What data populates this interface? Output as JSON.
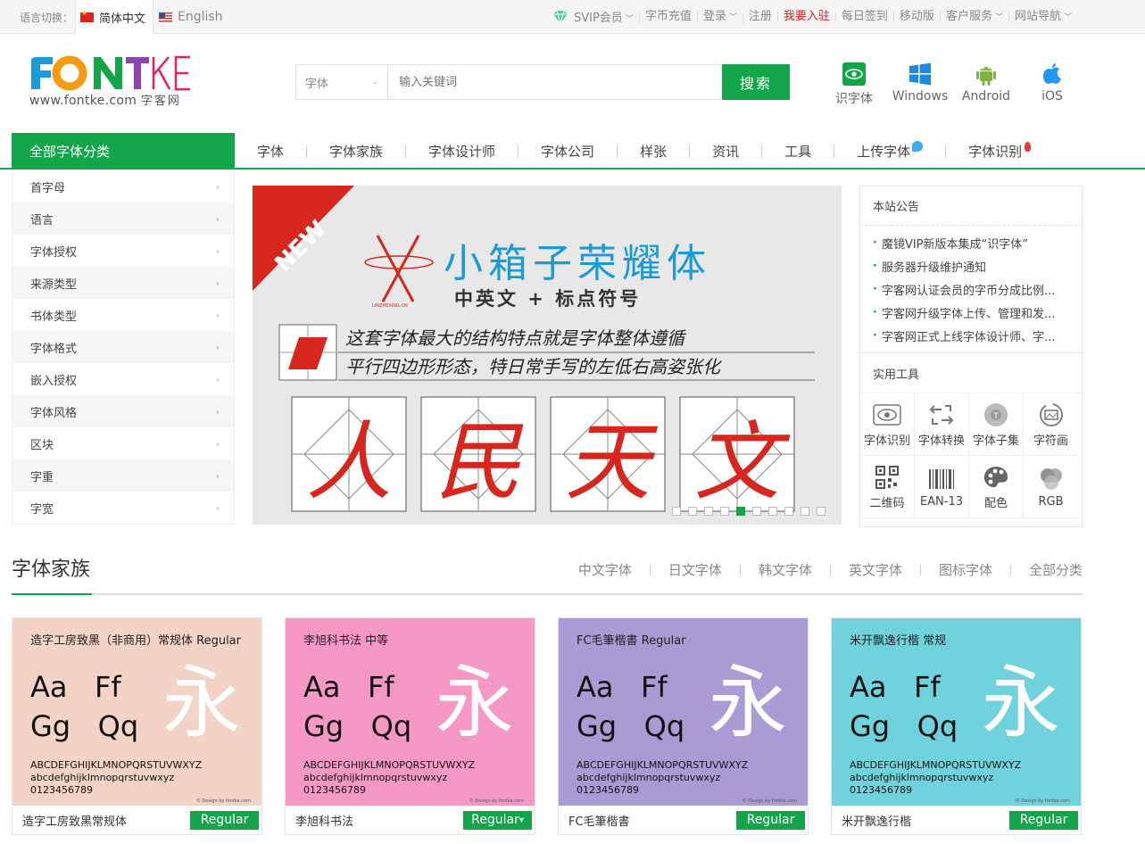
{
  "topbar": {
    "lang_label": "语言切换：",
    "lang_cn": "简体中文",
    "lang_en": "English",
    "links": [
      {
        "label": "SVIP会员",
        "arrow": true,
        "highlight": false
      },
      {
        "label": "字币充值",
        "arrow": false,
        "highlight": false
      },
      {
        "label": "登录",
        "arrow": true,
        "highlight": false
      },
      {
        "label": "注册",
        "arrow": false,
        "highlight": false
      },
      {
        "label": "我要入驻",
        "arrow": false,
        "highlight": true
      },
      {
        "label": "每日签到",
        "arrow": false,
        "highlight": false
      },
      {
        "label": "移动版",
        "arrow": false,
        "highlight": false
      },
      {
        "label": "客户服务",
        "arrow": true,
        "highlight": false
      },
      {
        "label": "网站导航",
        "arrow": true,
        "highlight": false
      }
    ]
  },
  "logo": {
    "text": "FONTKE",
    "url": "www.fontke.com",
    "cn": "字客网"
  },
  "search": {
    "select_value": "字体",
    "placeholder": "输入关键词",
    "button": "搜索"
  },
  "apps": [
    {
      "label": "识字体",
      "icon": "font-recognition-icon"
    },
    {
      "label": "Windows",
      "icon": "windows-icon"
    },
    {
      "label": "Android",
      "icon": "android-icon"
    },
    {
      "label": "iOS",
      "icon": "apple-icon"
    }
  ],
  "nav": {
    "all_label": "全部字体分类",
    "items": [
      "字体",
      "字体家族",
      "字体设计师",
      "字体公司",
      "样张",
      "资讯",
      "工具",
      "上传字体",
      "字体识别"
    ]
  },
  "sidebar": [
    "首字母",
    "语言",
    "字体授权",
    "来源类型",
    "书体类型",
    "字体格式",
    "嵌入授权",
    "字体风格",
    "区块",
    "字重",
    "字宽"
  ],
  "banner": {
    "ribbon": "NEW",
    "logo_small": "LINZHEXING.CN",
    "title": "小箱子荣耀体",
    "subtitle": "中英文 + 标点符号",
    "desc_line1": "这套字体最大的结构特点就是字体整体遵循",
    "desc_line2": "平行四边形形态，特日常手写的左低右高姿张化",
    "chars": [
      "人",
      "民",
      "天",
      "文"
    ],
    "slide_count": 10,
    "active_slide": 4
  },
  "announcements": {
    "title": "本站公告",
    "items": [
      "魔镜VIP新版本集成“识字体”",
      "服务器升级维护通知",
      "字客网认证会员的字币分成比例...",
      "字客网升级字体上传、管理和发...",
      "字客网正式上线字体设计师、字..."
    ]
  },
  "tools": {
    "title": "实用工具",
    "items": [
      {
        "label": "字体识别",
        "icon": "eye-icon"
      },
      {
        "label": "字体转换",
        "icon": "convert-icon"
      },
      {
        "label": "字体子集",
        "icon": "subset-icon"
      },
      {
        "label": "字符画",
        "icon": "picture-icon"
      },
      {
        "label": "二维码",
        "icon": "qrcode-icon"
      },
      {
        "label": "EAN-13",
        "icon": "barcode-icon"
      },
      {
        "label": "配色",
        "icon": "palette-icon"
      },
      {
        "label": "RGB",
        "icon": "rgb-icon"
      }
    ]
  },
  "family_section": {
    "title": "字体家族",
    "categories": [
      "中文字体",
      "日文字体",
      "韩文字体",
      "英文字体",
      "图标字体",
      "全部分类"
    ]
  },
  "cards": [
    {
      "name": "造字工房致黑常规体",
      "badge": "Regular",
      "has_dropdown": false,
      "bg": "#f3d3c5",
      "preview_title": "造字工房致黑（非商用）常规体 Regular",
      "glyphs_1": "Aa   Ff",
      "glyphs_2": "Gg   Qq",
      "yong": "永",
      "upper": "ABCDEFGHIJKLMNOPQRSTUVWXYZ",
      "lower": "abcdefghijklmnopqrstuvwxyz",
      "digits": "0123456789",
      "credit": "© Design by fontke.com"
    },
    {
      "name": "李旭科书法",
      "badge": "Regular",
      "has_dropdown": true,
      "bg": "#f598c6",
      "preview_title": "李旭科书法 中等",
      "glyphs_1": "Aa   Ff",
      "glyphs_2": "Gg   Qq",
      "yong": "永",
      "upper": "ABCDEFGHIJKLMNOPQRSTUVWXYZ",
      "lower": "abcdefghijklmnopqrstuvwxyz",
      "digits": "0123456789",
      "credit": "© Design by fontke.com"
    },
    {
      "name": "FC毛筆楷書",
      "badge": "Regular",
      "has_dropdown": false,
      "bg": "#a99bd3",
      "preview_title": "FC毛筆楷書 Regular",
      "glyphs_1": "Aa   Ff",
      "glyphs_2": "Gg   Qq",
      "yong": "永",
      "upper": "ABCDEFGHIJKLMNOPQRSTUVWXYZ",
      "lower": "abcdefghijklmnopqrstuvwxyz",
      "digits": "0123456789",
      "credit": "© Design by fontke.com"
    },
    {
      "name": "米开飘逸行楷",
      "badge": "Regular",
      "has_dropdown": false,
      "bg": "#6fd2dc",
      "preview_title": "米开飘逸行楷 常规",
      "glyphs_1": "Aa   Ff",
      "glyphs_2": "Gg   Qq",
      "yong": "永",
      "upper": "ABCDEFGHIJKLMNOPQRSTUVWXYZ",
      "lower": "abcdefghijklmnopqrstuvwxyz",
      "digits": "0123456789",
      "credit": "© Design by fontke.com"
    }
  ],
  "colors": {
    "accent": "#13a54a",
    "highlight": "#e02020"
  }
}
